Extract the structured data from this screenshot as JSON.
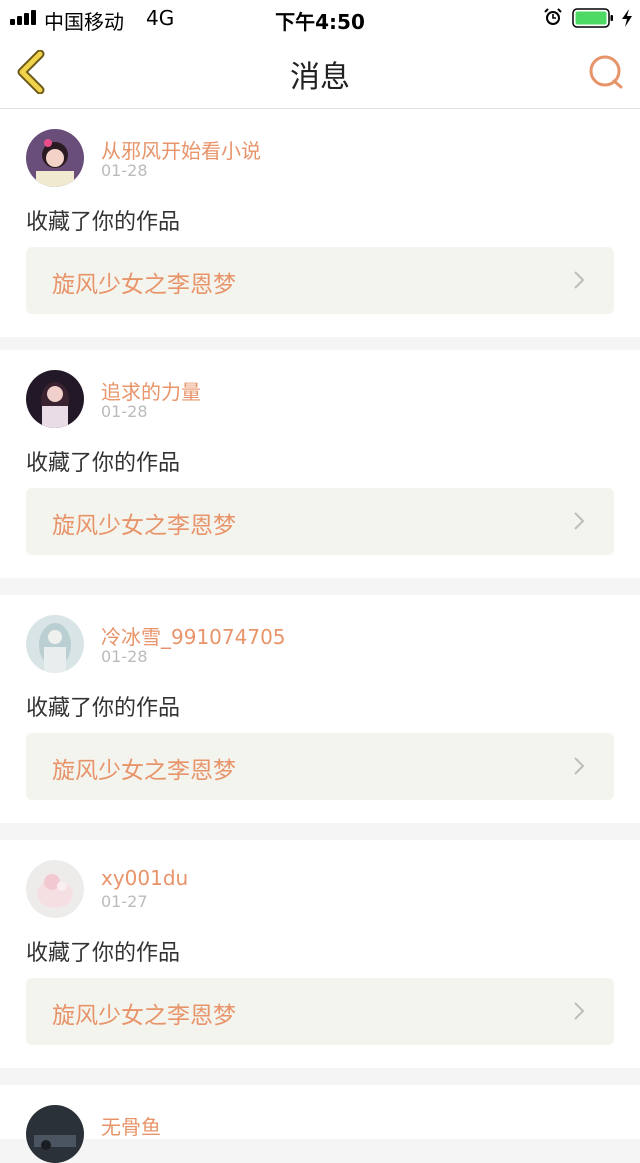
{
  "status_bar": {
    "carrier": "中国移动",
    "network": "4G",
    "time": "下午4:50"
  },
  "header": {
    "title": "消息",
    "back_icon": "chevron-left-icon",
    "search_icon": "search-icon"
  },
  "colors": {
    "accent": "#e8946a",
    "back_yellow": "#f2d24b",
    "work_box": "#f4f4ee",
    "battery_green": "#4cd964"
  },
  "messages": [
    {
      "user": "从邪风开始看小说",
      "date": "01-28",
      "action": "收藏了你的作品",
      "work": "旋风少女之李恩梦"
    },
    {
      "user": "追求的力量",
      "date": "01-28",
      "action": "收藏了你的作品",
      "work": "旋风少女之李恩梦"
    },
    {
      "user": "冷冰雪_991074705",
      "date": "01-28",
      "action": "收藏了你的作品",
      "work": "旋风少女之李恩梦"
    },
    {
      "user": "xy001du",
      "date": "01-27",
      "action": "收藏了你的作品",
      "work": "旋风少女之李恩梦"
    },
    {
      "user": "无骨鱼",
      "date": "",
      "action": "",
      "work": ""
    }
  ]
}
